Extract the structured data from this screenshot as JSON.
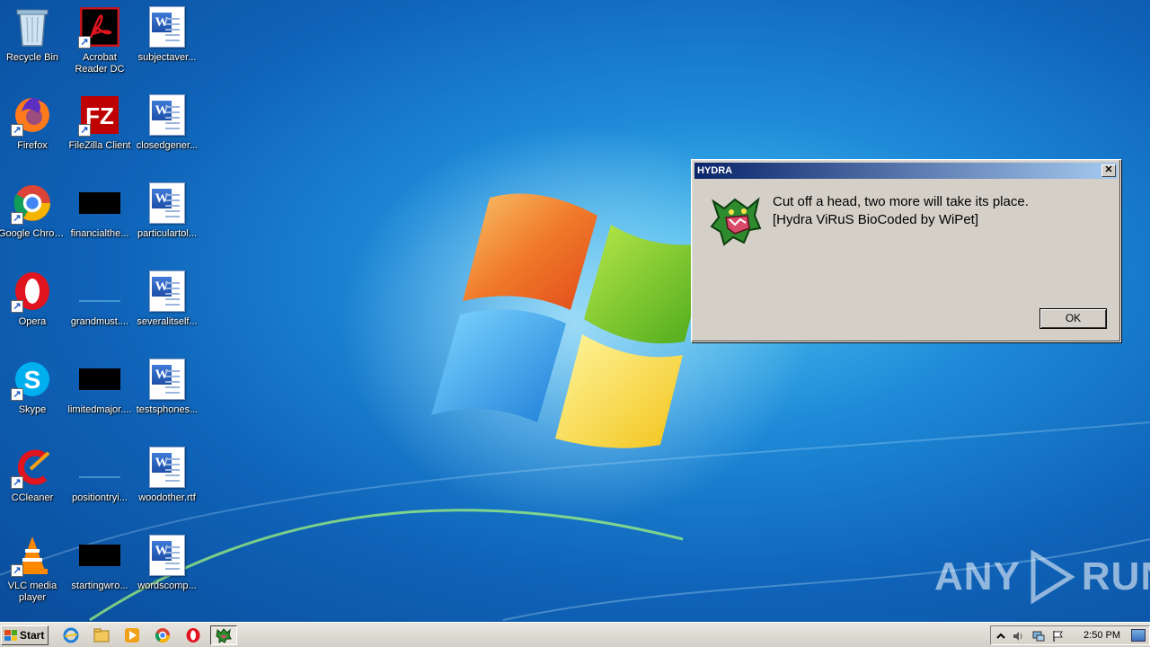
{
  "desktop": {
    "icons": [
      {
        "label": "Recycle Bin",
        "icon": "recycle-bin-icon"
      },
      {
        "label": "Acrobat Reader DC",
        "icon": "acrobat-icon"
      },
      {
        "label": "subjectaver...",
        "icon": "word-doc-icon"
      },
      {
        "label": "Firefox",
        "icon": "firefox-icon"
      },
      {
        "label": "FileZilla Client",
        "icon": "filezilla-icon"
      },
      {
        "label": "closedgener...",
        "icon": "word-doc-icon"
      },
      {
        "label": "Google Chrome",
        "icon": "chrome-icon"
      },
      {
        "label": "financialthe...",
        "icon": "black-file-icon"
      },
      {
        "label": "particulartol...",
        "icon": "word-doc-icon"
      },
      {
        "label": "Opera",
        "icon": "opera-icon"
      },
      {
        "label": "grandmust....",
        "icon": "blank-file-icon"
      },
      {
        "label": "severalitself...",
        "icon": "word-doc-icon"
      },
      {
        "label": "Skype",
        "icon": "skype-icon"
      },
      {
        "label": "limitedmajor....",
        "icon": "black-file-icon"
      },
      {
        "label": "testsphones...",
        "icon": "word-doc-icon"
      },
      {
        "label": "CCleaner",
        "icon": "ccleaner-icon"
      },
      {
        "label": "positiontryi...",
        "icon": "blank-file-icon"
      },
      {
        "label": "woodother.rtf",
        "icon": "word-doc-icon"
      },
      {
        "label": "VLC media player",
        "icon": "vlc-icon"
      },
      {
        "label": "startingwro...",
        "icon": "black-file-icon"
      },
      {
        "label": "wordscomp...",
        "icon": "word-doc-icon"
      }
    ]
  },
  "dialog": {
    "title": "HYDRA",
    "close_label": "✕",
    "message_line1": "Cut off a head, two more will take its place.",
    "message_line2": "[Hydra ViRuS BioCoded by WiPet]",
    "ok_label": "OK"
  },
  "watermark": {
    "left": "ANY",
    "right": "RUN"
  },
  "taskbar": {
    "start_label": "Start",
    "pinned": [
      "ie-icon",
      "explorer-icon",
      "media-player-icon",
      "chrome-icon",
      "opera-icon",
      "hydra-app-icon"
    ],
    "clock": "2:50 PM"
  }
}
